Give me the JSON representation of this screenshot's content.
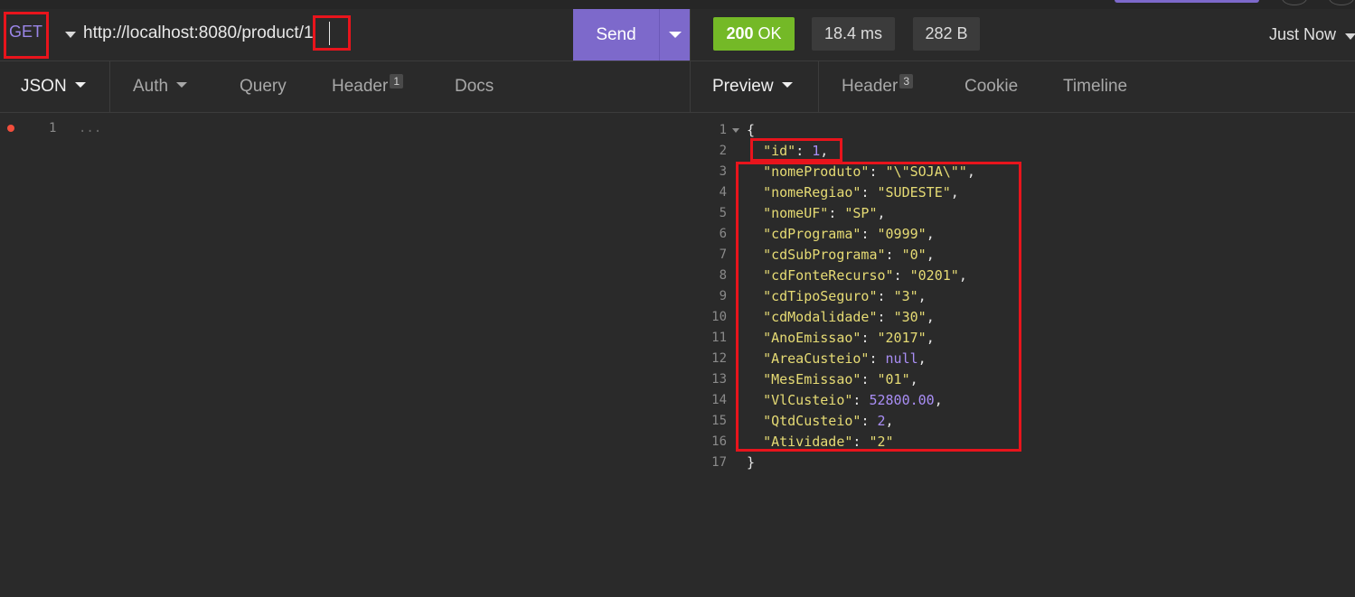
{
  "request": {
    "method": "GET",
    "url": "http://localhost:8080/product/1",
    "send_label": "Send"
  },
  "response": {
    "status_code": "200",
    "status_text": "OK",
    "time": "18.4 ms",
    "size": "282 B",
    "history_label": "Just Now"
  },
  "request_tabs": [
    {
      "label": "JSON",
      "active": true,
      "has_dropdown": true
    },
    {
      "label": "Auth",
      "active": false,
      "has_dropdown": true
    },
    {
      "label": "Query",
      "active": false
    },
    {
      "label": "Header",
      "active": false,
      "count": "1"
    },
    {
      "label": "Docs",
      "active": false
    }
  ],
  "response_tabs": [
    {
      "label": "Preview",
      "active": true,
      "has_dropdown": true
    },
    {
      "label": "Header",
      "active": false,
      "count": "3"
    },
    {
      "label": "Cookie",
      "active": false
    },
    {
      "label": "Timeline",
      "active": false
    }
  ],
  "editor": {
    "line_number": "1",
    "placeholder": "..."
  },
  "response_body": {
    "open_brace": "{",
    "close_brace": "}",
    "fields": [
      {
        "key": "id",
        "value": "1",
        "type": "number"
      },
      {
        "key": "nomeProduto",
        "value": "\\\"SOJA\\\"",
        "type": "string"
      },
      {
        "key": "nomeRegiao",
        "value": "SUDESTE",
        "type": "string"
      },
      {
        "key": "nomeUF",
        "value": "SP",
        "type": "string"
      },
      {
        "key": "cdPrograma",
        "value": "0999",
        "type": "string"
      },
      {
        "key": "cdSubPrograma",
        "value": "0",
        "type": "string"
      },
      {
        "key": "cdFonteRecurso",
        "value": "0201",
        "type": "string"
      },
      {
        "key": "cdTipoSeguro",
        "value": "3",
        "type": "string"
      },
      {
        "key": "cdModalidade",
        "value": "30",
        "type": "string"
      },
      {
        "key": "AnoEmissao",
        "value": "2017",
        "type": "string"
      },
      {
        "key": "AreaCusteio",
        "value": "null",
        "type": "null"
      },
      {
        "key": "MesEmissao",
        "value": "01",
        "type": "string"
      },
      {
        "key": "VlCusteio",
        "value": "52800.00",
        "type": "number"
      },
      {
        "key": "QtdCusteio",
        "value": "2",
        "type": "number"
      },
      {
        "key": "Atividade",
        "value": "2",
        "type": "string"
      }
    ]
  },
  "colors": {
    "accent": "#7d69cb",
    "status_ok": "#74b927",
    "highlight": "#e8141c",
    "json_string": "#e6db74",
    "json_number": "#a98ef5"
  }
}
